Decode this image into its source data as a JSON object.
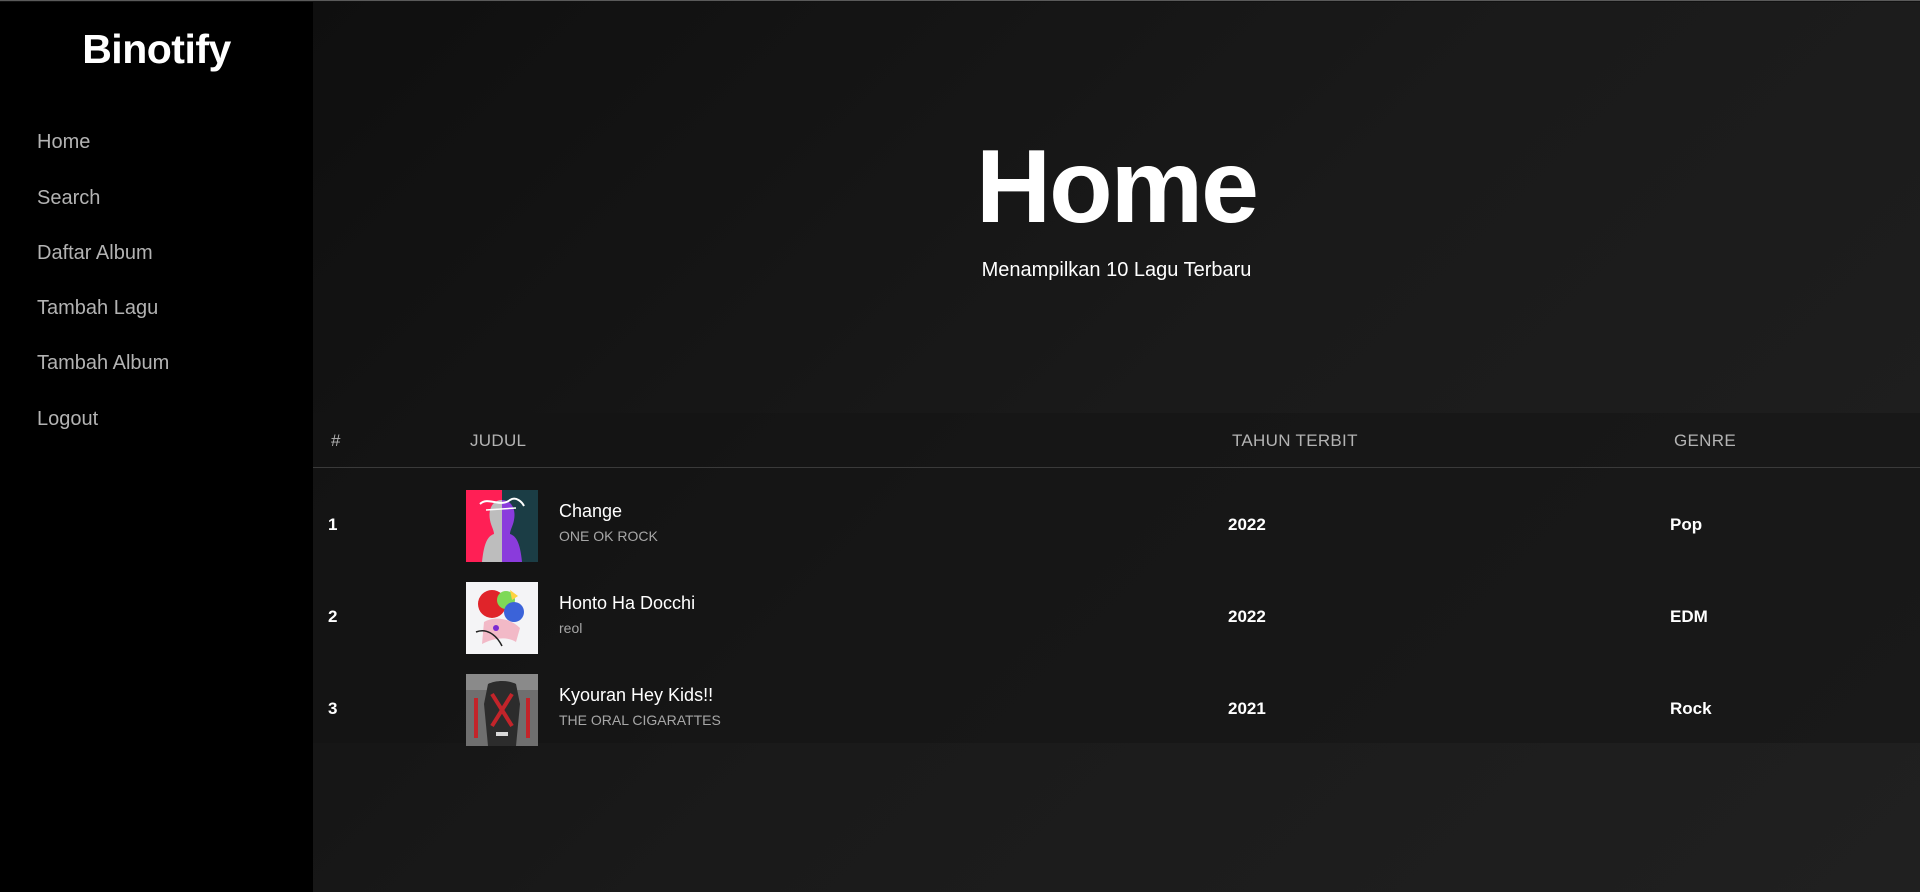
{
  "app": {
    "title": "Binotify"
  },
  "sidebar": {
    "items": [
      {
        "label": "Home"
      },
      {
        "label": "Search"
      },
      {
        "label": "Daftar Album"
      },
      {
        "label": "Tambah Lagu"
      },
      {
        "label": "Tambah Album"
      },
      {
        "label": "Logout"
      }
    ]
  },
  "main": {
    "title": "Home",
    "subtitle": "Menampilkan 10 Lagu Terbaru",
    "table": {
      "headers": [
        "#",
        "JUDUL",
        "TAHUN TERBIT",
        "GENRE"
      ],
      "rows": [
        {
          "index": "1",
          "title": "Change",
          "artist": "ONE OK ROCK",
          "year": "2022",
          "genre": "Pop",
          "cover_icon": "album-cover-change"
        },
        {
          "index": "2",
          "title": "Honto Ha Docchi",
          "artist": "reol",
          "year": "2022",
          "genre": "EDM",
          "cover_icon": "album-cover-honto-ha-docchi"
        },
        {
          "index": "3",
          "title": "Kyouran Hey Kids!!",
          "artist": "THE ORAL CIGARATTES",
          "year": "2021",
          "genre": "Rock",
          "cover_icon": "album-cover-kyouran-hey-kids"
        }
      ]
    }
  },
  "colors": {
    "sidebar_bg": "#000000",
    "main_bg": "#121212",
    "text_primary": "#ffffff",
    "text_secondary": "#b3b3b3"
  }
}
